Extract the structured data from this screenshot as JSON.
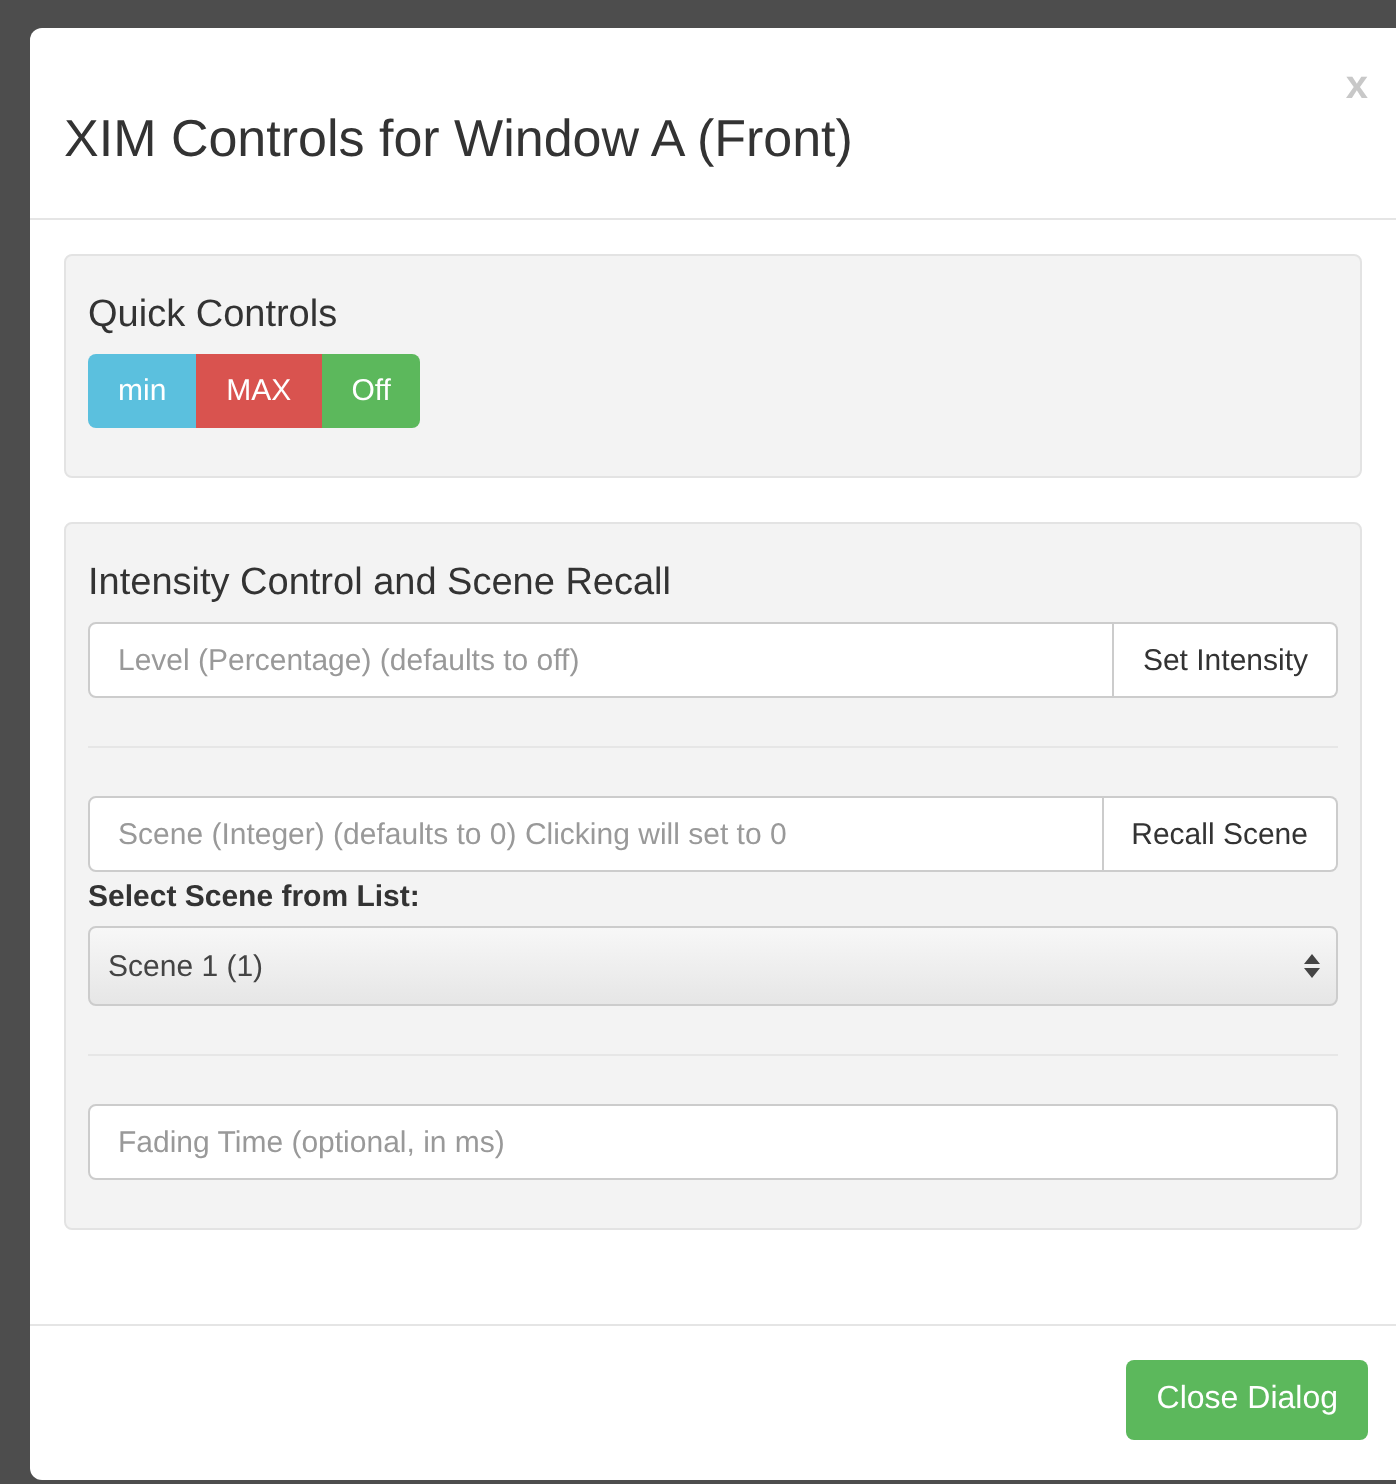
{
  "dialog": {
    "title": "XIM Controls for Window A (Front)",
    "close_glyph": "x"
  },
  "quick_controls": {
    "heading": "Quick Controls",
    "buttons": [
      {
        "label": "min",
        "kind": "info"
      },
      {
        "label": "MAX",
        "kind": "danger"
      },
      {
        "label": "Off",
        "kind": "success"
      }
    ]
  },
  "intensity": {
    "heading": "Intensity Control and Scene Recall",
    "level_field": {
      "placeholder": "Level (Percentage) (defaults to off)",
      "button": "Set Intensity"
    },
    "scene_field": {
      "placeholder": "Scene (Integer) (defaults to 0) Clicking will set to 0",
      "button": "Recall Scene"
    },
    "scene_select": {
      "label": "Select Scene from List:",
      "value": "Scene 1 (1)"
    },
    "fading_field": {
      "placeholder": "Fading Time (optional, in ms)"
    }
  },
  "footer": {
    "button": "Close Dialog"
  }
}
